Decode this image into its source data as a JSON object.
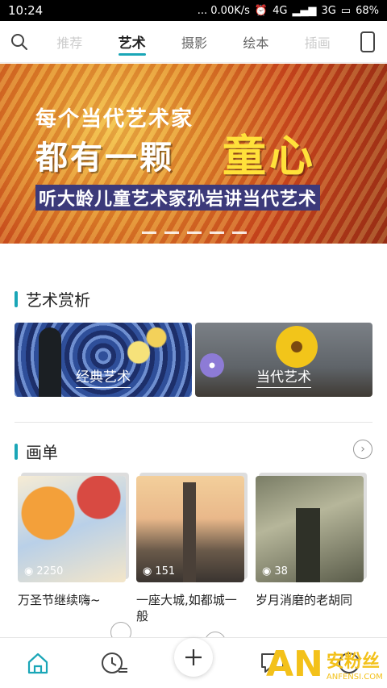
{
  "status": {
    "time": "10:24",
    "speed": "... 0.00K/s",
    "network1": "4G",
    "network2": "3G",
    "battery": "68%"
  },
  "tabs": [
    {
      "label": "推荐"
    },
    {
      "label": "艺术"
    },
    {
      "label": "摄影"
    },
    {
      "label": "绘本"
    },
    {
      "label": "插画"
    }
  ],
  "banner": {
    "line1": "每个当代艺术家",
    "line2": "都有一颗",
    "line2_highlight": "童心",
    "line3": "听大龄儿童艺术家孙岩讲当代艺术",
    "page_count": 5
  },
  "art_section": {
    "title": "艺术赏析",
    "cards": [
      {
        "label": "经典艺术"
      },
      {
        "label": "当代艺术"
      }
    ]
  },
  "album_section": {
    "title": "画单",
    "more_icon": "chevron-right-icon",
    "albums": [
      {
        "title": "万圣节继续嗨~",
        "views": "2250"
      },
      {
        "title": "一座大城,如都城一般",
        "views": "151"
      },
      {
        "title": "岁月消磨的老胡同",
        "views": "38"
      }
    ]
  },
  "bottom_nav": [
    {
      "icon": "home-icon"
    },
    {
      "icon": "history-icon"
    },
    {
      "icon": "plus-icon"
    },
    {
      "icon": "message-icon"
    },
    {
      "icon": "profile-icon"
    }
  ],
  "watermark": {
    "brand": "AN",
    "zh": "安粉丝",
    "en": "ANFENSI.COM"
  },
  "colors": {
    "accent": "#1aa6b7",
    "highlight": "#ffe13a"
  }
}
